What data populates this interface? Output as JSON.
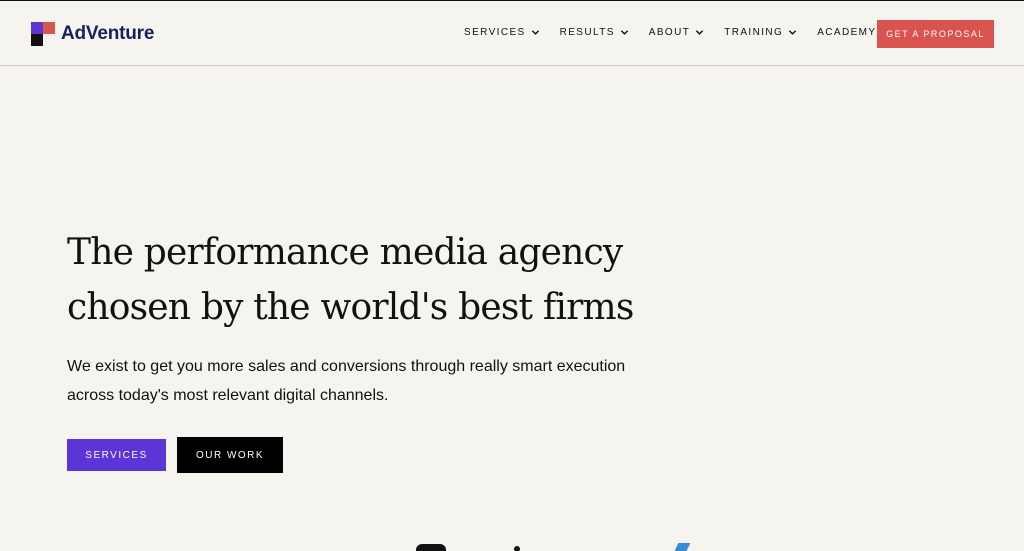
{
  "brand": {
    "name": "AdVenture",
    "colors": {
      "purple": "#5b35d5",
      "red": "#d9534f",
      "black": "#111111",
      "navy": "#1a1f5e"
    }
  },
  "nav": {
    "items": [
      {
        "label": "SERVICES",
        "has_dropdown": true
      },
      {
        "label": "RESULTS",
        "has_dropdown": true
      },
      {
        "label": "ABOUT",
        "has_dropdown": true
      },
      {
        "label": "TRAINING",
        "has_dropdown": true
      },
      {
        "label": "ACADEMY",
        "has_dropdown": false
      }
    ],
    "cta_label": "GET A PROPOSAL"
  },
  "hero": {
    "title_line1": "The performance media agency",
    "title_line2": "chosen by the world's best firms",
    "subtitle_line1": "We exist to get you more sales and conversions through really smart execution",
    "subtitle_line2": "across today's most relevant digital channels.",
    "primary_button": "SERVICES",
    "secondary_button": "OUR WORK"
  }
}
